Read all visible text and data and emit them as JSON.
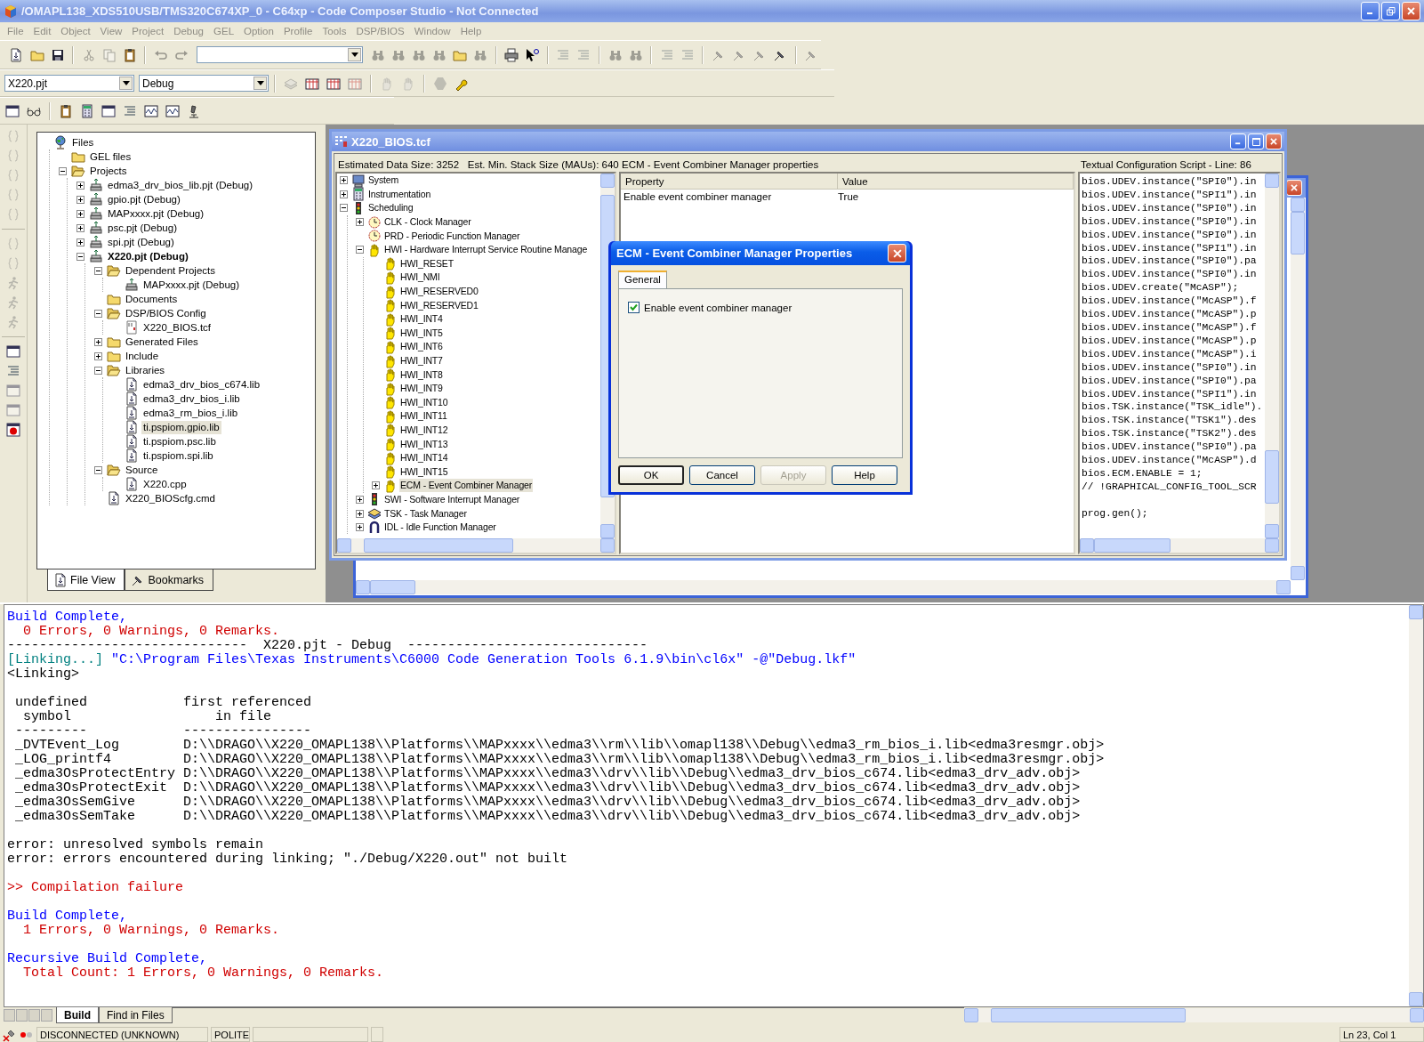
{
  "window": {
    "title": "/OMAPL138_XDS510USB/TMS320C674XP_0 - C64xp - Code Composer Studio - Not Connected"
  },
  "menu": [
    "File",
    "Edit",
    "Object",
    "View",
    "Project",
    "Debug",
    "GEL",
    "Option",
    "Profile",
    "Tools",
    "DSP/BIOS",
    "Window",
    "Help"
  ],
  "toolbar": {
    "project_select": "X220.pjt",
    "config_select": "Debug"
  },
  "project_view": {
    "tree": [
      {
        "label": "Files",
        "kind": "root",
        "selected": false,
        "children": [
          {
            "label": "GEL files",
            "kind": "folder",
            "selected": false
          },
          {
            "label": "Projects",
            "kind": "folder",
            "expanded": true,
            "selected": false,
            "children": [
              {
                "label": "edma3_drv_bios_lib.pjt (Debug)",
                "kind": "project",
                "expanded": false,
                "active": false,
                "selected": false
              },
              {
                "label": "gpio.pjt (Debug)",
                "kind": "project",
                "expanded": false,
                "active": false,
                "selected": false
              },
              {
                "label": "MAPxxxx.pjt (Debug)",
                "kind": "project",
                "expanded": false,
                "active": false,
                "selected": false
              },
              {
                "label": "psc.pjt (Debug)",
                "kind": "project",
                "expanded": false,
                "active": false,
                "selected": false
              },
              {
                "label": "spi.pjt (Debug)",
                "kind": "project",
                "expanded": false,
                "active": false,
                "selected": false
              },
              {
                "label": "X220.pjt (Debug)",
                "kind": "project",
                "expanded": true,
                "active": true,
                "selected": false,
                "children": [
                  {
                    "label": "Dependent Projects",
                    "kind": "folder",
                    "expanded": true,
                    "selected": false,
                    "children": [
                      {
                        "label": "MAPxxxx.pjt (Debug)",
                        "kind": "project",
                        "active": false,
                        "selected": false
                      }
                    ]
                  },
                  {
                    "label": "Documents",
                    "kind": "folder",
                    "selected": false
                  },
                  {
                    "label": "DSP/BIOS Config",
                    "kind": "folder",
                    "expanded": true,
                    "selected": false,
                    "children": [
                      {
                        "label": "X220_BIOS.tcf",
                        "kind": "config",
                        "selected": false
                      }
                    ]
                  },
                  {
                    "label": "Generated Files",
                    "kind": "folder",
                    "expanded": false,
                    "selected": false
                  },
                  {
                    "label": "Include",
                    "kind": "folder",
                    "expanded": false,
                    "selected": false
                  },
                  {
                    "label": "Libraries",
                    "kind": "folder",
                    "expanded": true,
                    "selected": false,
                    "children": [
                      {
                        "label": "edma3_drv_bios_c674.lib",
                        "kind": "file",
                        "selected": false
                      },
                      {
                        "label": "edma3_drv_bios_i.lib",
                        "kind": "file",
                        "selected": false
                      },
                      {
                        "label": "edma3_rm_bios_i.lib",
                        "kind": "file",
                        "selected": false
                      },
                      {
                        "label": "ti.pspiom.gpio.lib",
                        "kind": "file",
                        "selected": true
                      },
                      {
                        "label": "ti.pspiom.psc.lib",
                        "kind": "file",
                        "selected": false
                      },
                      {
                        "label": "ti.pspiom.spi.lib",
                        "kind": "file",
                        "selected": false
                      }
                    ]
                  },
                  {
                    "label": "Source",
                    "kind": "folder",
                    "expanded": true,
                    "selected": false,
                    "children": [
                      {
                        "label": "X220.cpp",
                        "kind": "file",
                        "selected": false
                      }
                    ]
                  },
                  {
                    "label": "X220_BIOScfg.cmd",
                    "kind": "file",
                    "selected": false
                  }
                ]
              }
            ]
          }
        ]
      }
    ],
    "tabs": [
      {
        "label": "File View",
        "selected": true
      },
      {
        "label": "Bookmarks",
        "selected": false
      }
    ]
  },
  "config_window": {
    "title": "X220_BIOS.tcf",
    "summary": "Estimated Data Size: 3252   Est. Min. Stack Size (MAUs): 640",
    "tree": [
      {
        "label": "System",
        "kind": "system",
        "expanded": false,
        "selected": false
      },
      {
        "label": "Instrumentation",
        "kind": "instrumentation",
        "expanded": false,
        "selected": false
      },
      {
        "label": "Scheduling",
        "kind": "scheduling",
        "expanded": true,
        "selected": false,
        "children": [
          {
            "label": "CLK - Clock Manager",
            "kind": "clock",
            "expanded": false,
            "selected": false
          },
          {
            "label": "PRD - Periodic Function Manager",
            "kind": "periodic",
            "selected": false
          },
          {
            "label": "HWI - Hardware Interrupt Service Routine Manage",
            "kind": "interrupt",
            "expanded": true,
            "selected": false,
            "children": [
              {
                "label": "HWI_RESET",
                "kind": "interrupt",
                "selected": false
              },
              {
                "label": "HWI_NMI",
                "kind": "interrupt",
                "selected": false
              },
              {
                "label": "HWI_RESERVED0",
                "kind": "interrupt",
                "selected": false
              },
              {
                "label": "HWI_RESERVED1",
                "kind": "interrupt",
                "selected": false
              },
              {
                "label": "HWI_INT4",
                "kind": "interrupt",
                "selected": false
              },
              {
                "label": "HWI_INT5",
                "kind": "interrupt",
                "selected": false
              },
              {
                "label": "HWI_INT6",
                "kind": "interrupt",
                "selected": false
              },
              {
                "label": "HWI_INT7",
                "kind": "interrupt",
                "selected": false
              },
              {
                "label": "HWI_INT8",
                "kind": "interrupt",
                "selected": false
              },
              {
                "label": "HWI_INT9",
                "kind": "interrupt",
                "selected": false
              },
              {
                "label": "HWI_INT10",
                "kind": "interrupt",
                "selected": false
              },
              {
                "label": "HWI_INT11",
                "kind": "interrupt",
                "selected": false
              },
              {
                "label": "HWI_INT12",
                "kind": "interrupt",
                "selected": false
              },
              {
                "label": "HWI_INT13",
                "kind": "interrupt",
                "selected": false
              },
              {
                "label": "HWI_INT14",
                "kind": "interrupt",
                "selected": false
              },
              {
                "label": "HWI_INT15",
                "kind": "interrupt",
                "selected": false
              },
              {
                "label": "ECM - Event Combiner Manager",
                "kind": "interrupt",
                "expanded": false,
                "selected": true
              }
            ]
          },
          {
            "label": "SWI - Software Interrupt Manager",
            "kind": "software-interrupt",
            "expanded": false,
            "selected": false
          },
          {
            "label": "TSK - Task Manager",
            "kind": "task",
            "expanded": false,
            "selected": false
          },
          {
            "label": "IDL - Idle Function Manager",
            "kind": "idle",
            "expanded": false,
            "selected": false
          }
        ]
      }
    ],
    "properties": {
      "title": "ECM - Event Combiner Manager properties",
      "columns": [
        "Property",
        "Value"
      ],
      "rows": [
        {
          "property": "Enable event combiner manager",
          "value": "True"
        }
      ]
    },
    "script": {
      "title": "Textual Configuration Script - Line: 86",
      "lines": [
        {
          "text": "bios.UDEV.instance(\"SPI0\").in"
        },
        {
          "text": "bios.UDEV.instance(\"SPI1\").in"
        },
        {
          "text": "bios.UDEV.instance(\"SPI0\").in"
        },
        {
          "text": "bios.UDEV.instance(\"SPI0\").in"
        },
        {
          "text": "bios.UDEV.instance(\"SPI0\").in"
        },
        {
          "text": "bios.UDEV.instance(\"SPI1\").in"
        },
        {
          "text": "bios.UDEV.instance(\"SPI0\").pa"
        },
        {
          "text": "bios.UDEV.instance(\"SPI0\").in"
        },
        {
          "text": "bios.UDEV.create(\"McASP\");"
        },
        {
          "text": "bios.UDEV.instance(\"McASP\").f"
        },
        {
          "text": "bios.UDEV.instance(\"McASP\").p"
        },
        {
          "text": "bios.UDEV.instance(\"McASP\").f"
        },
        {
          "text": "bios.UDEV.instance(\"McASP\").p"
        },
        {
          "text": "bios.UDEV.instance(\"McASP\").i"
        },
        {
          "text": "bios.UDEV.instance(\"SPI0\").in"
        },
        {
          "text": "bios.UDEV.instance(\"SPI0\").pa"
        },
        {
          "text": "bios.UDEV.instance(\"SPI1\").in"
        },
        {
          "text": "bios.TSK.instance(\"TSK_idle\")."
        },
        {
          "text": "bios.TSK.instance(\"TSK1\").des"
        },
        {
          "text": "bios.TSK.instance(\"TSK2\").des"
        },
        {
          "text": "bios.UDEV.instance(\"SPI0\").pa"
        },
        {
          "text": "bios.UDEV.instance(\"McASP\").d"
        },
        {
          "text": "bios.ECM.ENABLE = 1;"
        },
        {
          "text": "// !GRAPHICAL_CONFIG_TOOL_SCR"
        },
        {
          "text": "prog.gen();",
          "space_before": true
        }
      ]
    }
  },
  "dialog": {
    "title": "ECM - Event Combiner Manager Properties",
    "tabs": [
      {
        "label": "General",
        "selected": true
      }
    ],
    "checkbox": {
      "label": "Enable event combiner manager",
      "checked": true
    },
    "buttons": [
      {
        "label": "OK",
        "default": true,
        "disabled": false
      },
      {
        "label": "Cancel",
        "default": false,
        "disabled": false
      },
      {
        "label": "Apply",
        "default": false,
        "disabled": true
      },
      {
        "label": "Help",
        "default": false,
        "disabled": false
      }
    ]
  },
  "output": {
    "lines": [
      {
        "text": "Build Complete,",
        "kind": "status"
      },
      {
        "text": "  0 Errors, 0 Warnings, 0 Remarks.",
        "kind": "error"
      },
      {
        "text": "------------------------------  X220.pjt - Debug  ------------------------------",
        "kind": "plain"
      },
      {
        "text": "[Linking...]",
        "kind": "step",
        "detail": "\"C:\\Program Files\\Texas Instruments\\C6000 Code Generation Tools 6.1.9\\bin\\cl6x\" -@\"Debug.lkf\""
      },
      {
        "text": "<Linking>",
        "kind": "plain"
      },
      {
        "text": " undefined            first referenced",
        "kind": "plain",
        "space_before": true
      },
      {
        "text": "  symbol                  in file",
        "kind": "plain"
      },
      {
        "text": " ---------            ----------------",
        "kind": "plain"
      },
      {
        "text": " _DVTEvent_Log        D:\\\\DRAGO\\\\X220_OMAPL138\\\\Platforms\\\\MAPxxxx\\\\edma3\\\\rm\\\\lib\\\\omapl138\\\\Debug\\\\edma3_rm_bios_i.lib<edma3resmgr.obj>",
        "kind": "plain"
      },
      {
        "text": " _LOG_printf4         D:\\\\DRAGO\\\\X220_OMAPL138\\\\Platforms\\\\MAPxxxx\\\\edma3\\\\rm\\\\lib\\\\omapl138\\\\Debug\\\\edma3_rm_bios_i.lib<edma3resmgr.obj>",
        "kind": "plain"
      },
      {
        "text": " _edma3OsProtectEntry D:\\\\DRAGO\\\\X220_OMAPL138\\\\Platforms\\\\MAPxxxx\\\\edma3\\\\drv\\\\lib\\\\Debug\\\\edma3_drv_bios_c674.lib<edma3_drv_adv.obj>",
        "kind": "plain"
      },
      {
        "text": " _edma3OsProtectExit  D:\\\\DRAGO\\\\X220_OMAPL138\\\\Platforms\\\\MAPxxxx\\\\edma3\\\\drv\\\\lib\\\\Debug\\\\edma3_drv_bios_c674.lib<edma3_drv_adv.obj>",
        "kind": "plain"
      },
      {
        "text": " _edma3OsSemGive      D:\\\\DRAGO\\\\X220_OMAPL138\\\\Platforms\\\\MAPxxxx\\\\edma3\\\\drv\\\\lib\\\\Debug\\\\edma3_drv_bios_c674.lib<edma3_drv_adv.obj>",
        "kind": "plain"
      },
      {
        "text": " _edma3OsSemTake      D:\\\\DRAGO\\\\X220_OMAPL138\\\\Platforms\\\\MAPxxxx\\\\edma3\\\\drv\\\\lib\\\\Debug\\\\edma3_drv_bios_c674.lib<edma3_drv_adv.obj>",
        "kind": "plain"
      },
      {
        "text": "error: unresolved symbols remain",
        "kind": "plain",
        "space_before": true
      },
      {
        "text": "error: errors encountered during linking; \"./Debug/X220.out\" not built",
        "kind": "plain"
      },
      {
        "text": ">> Compilation failure",
        "kind": "error",
        "space_before": true
      },
      {
        "text": "Build Complete,",
        "kind": "status",
        "space_before": true
      },
      {
        "text": "  1 Errors, 0 Warnings, 0 Remarks.",
        "kind": "error"
      },
      {
        "text": "Recursive Build Complete,",
        "kind": "status",
        "space_before": true
      },
      {
        "text": "  Total Count: 1 Errors, 0 Warnings, 0 Remarks.",
        "kind": "error"
      }
    ],
    "tabs": [
      {
        "label": "Build",
        "selected": true
      },
      {
        "label": "Find in Files",
        "selected": false
      }
    ]
  },
  "status_bar": {
    "connection": "DISCONNECTED (UNKNOWN)",
    "mode": "POLITE",
    "position": "Ln 23, Col 1"
  }
}
